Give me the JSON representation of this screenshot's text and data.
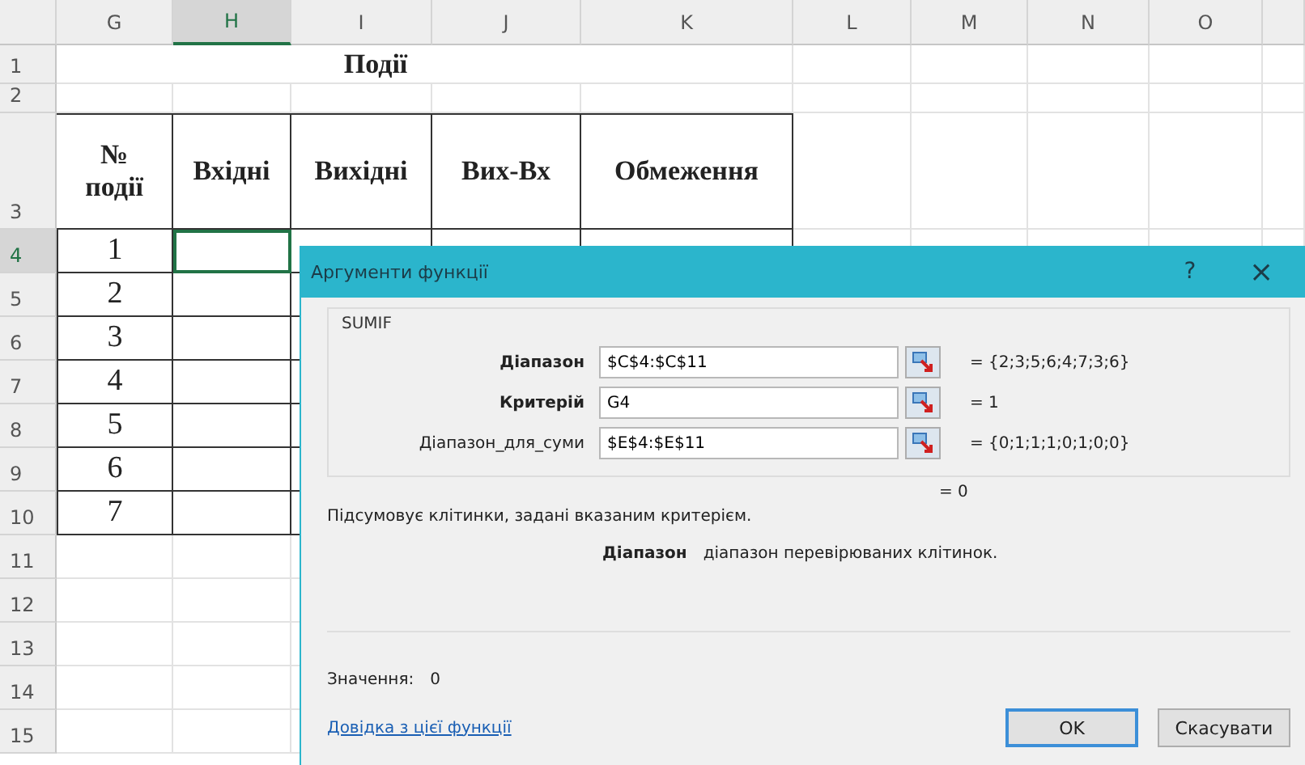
{
  "sheet": {
    "columns": [
      {
        "label": "G",
        "selected": false
      },
      {
        "label": "H",
        "selected": true
      },
      {
        "label": "I",
        "selected": false
      },
      {
        "label": "J",
        "selected": false
      },
      {
        "label": "K",
        "selected": false
      },
      {
        "label": "L",
        "selected": false
      },
      {
        "label": "M",
        "selected": false
      },
      {
        "label": "N",
        "selected": false
      },
      {
        "label": "O",
        "selected": false
      }
    ],
    "rows": [
      {
        "label": "1",
        "selected": false
      },
      {
        "label": "2",
        "selected": false
      },
      {
        "label": "3",
        "selected": false
      },
      {
        "label": "4",
        "selected": true
      },
      {
        "label": "5",
        "selected": false
      },
      {
        "label": "6",
        "selected": false
      },
      {
        "label": "7",
        "selected": false
      },
      {
        "label": "8",
        "selected": false
      },
      {
        "label": "9",
        "selected": false
      },
      {
        "label": "10",
        "selected": false
      },
      {
        "label": "11",
        "selected": false
      },
      {
        "label": "12",
        "selected": false
      },
      {
        "label": "13",
        "selected": false
      },
      {
        "label": "14",
        "selected": false
      },
      {
        "label": "15",
        "selected": false
      }
    ],
    "title": "Події",
    "headers": [
      {
        "lines": [
          "№",
          "події"
        ]
      },
      {
        "lines": [
          "Вхідні"
        ]
      },
      {
        "lines": [
          "Вихідні"
        ]
      },
      {
        "lines": [
          "Вих-Вх"
        ]
      },
      {
        "lines": [
          "Обмеження"
        ]
      }
    ],
    "event_numbers": [
      "1",
      "2",
      "3",
      "4",
      "5",
      "6",
      "7"
    ]
  },
  "dialog": {
    "title": "Аргументи функції",
    "help": "?",
    "close": "×",
    "function": "SUMIF",
    "arguments": [
      {
        "label": "Діапазон",
        "required": true,
        "value": "$C$4:$C$11",
        "result": "= {2;3;5;6;4;7;3;6}"
      },
      {
        "label": "Критерій",
        "required": true,
        "value": "G4",
        "result": "= 1"
      },
      {
        "label": "Діапазон_для_суми",
        "required": false,
        "value": "$E$4:$E$11",
        "result": "= {0;1;1;1;0;1;0;0}"
      }
    ],
    "formula_result": "= 0",
    "description": "Підсумовує клітинки, задані вказаним критерієм.",
    "argument_help": {
      "name": "Діапазон",
      "text": "діапазон перевірюваних клітинок."
    },
    "value_label": "Значення:",
    "value": "0",
    "help_link": "Довідка з цієї функції",
    "buttons": [
      {
        "label": "OK",
        "default": true
      },
      {
        "label": "Скасувати",
        "default": false
      }
    ]
  }
}
